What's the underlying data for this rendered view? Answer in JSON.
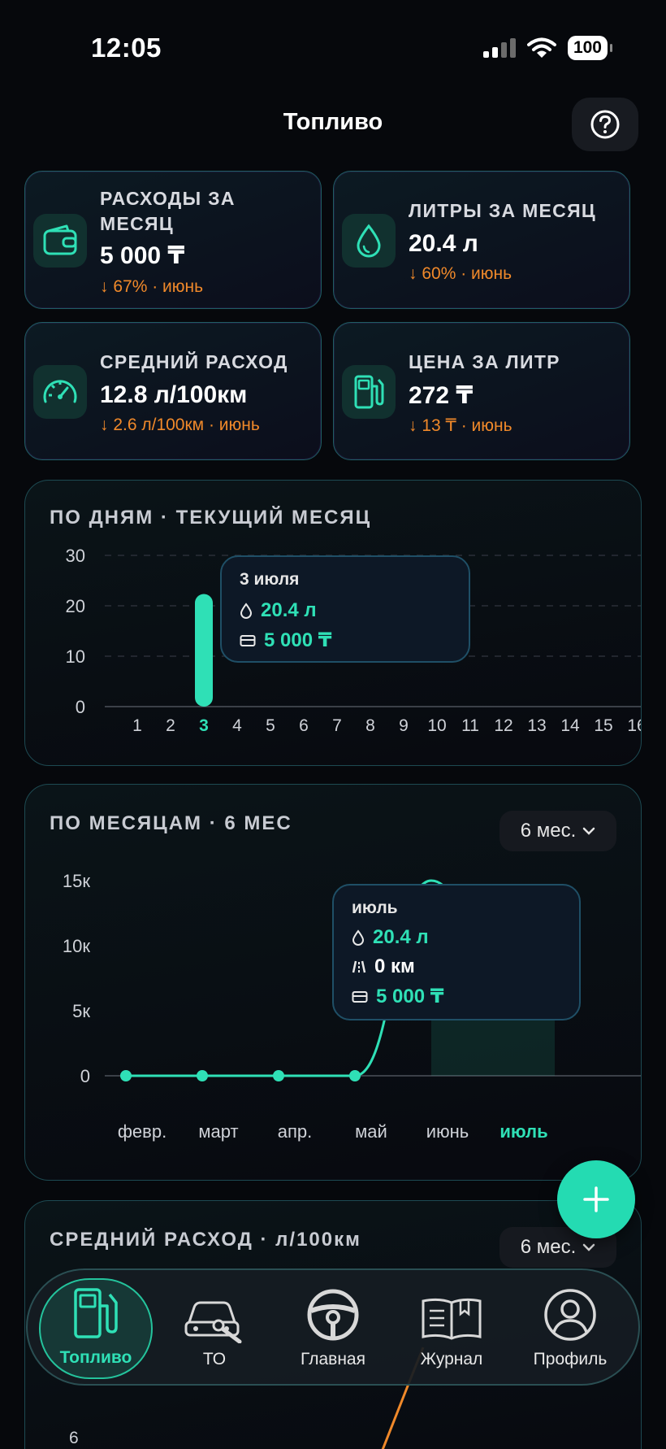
{
  "status": {
    "time": "12:05",
    "battery": "100"
  },
  "header": {
    "title": "Топливо"
  },
  "stats": [
    {
      "label": "РАСХОДЫ ЗА МЕСЯЦ",
      "value": "5 000 ₸",
      "delta": "↓ 67% · июнь",
      "icon": "wallet-icon"
    },
    {
      "label": "ЛИТРЫ ЗА МЕСЯЦ",
      "value": "20.4 л",
      "delta": "↓ 60% · июнь",
      "icon": "droplet-icon"
    },
    {
      "label": "СРЕДНИЙ РАСХОД",
      "value": "12.8 л/100км",
      "delta": "↓ 2.6 л/100км · июнь",
      "icon": "speedometer-icon"
    },
    {
      "label": "ЦЕНА ЗА ЛИТР",
      "value": "272 ₸",
      "delta": "↓ 13 ₸ · июнь",
      "icon": "fuel-pump-icon"
    }
  ],
  "daily": {
    "title": "ПО ДНЯМ · ТЕКУЩИЙ МЕСЯЦ",
    "tooltip": {
      "date": "3 июля",
      "liters": "20.4 л",
      "cost": "5 000 ₸"
    }
  },
  "monthly": {
    "title": "ПО МЕСЯЦАМ · 6 МЕС",
    "period": "6 мес.",
    "tooltip": {
      "month": "июль",
      "liters": "20.4 л",
      "distance": "0 км",
      "cost": "5 000 ₸"
    }
  },
  "avg": {
    "title": "СРЕДНИЙ РАСХОД · л/100км",
    "period": "6 мес.",
    "y_tick": "6"
  },
  "chart_data": [
    {
      "type": "bar",
      "title": "ПО ДНЯМ · ТЕКУЩИЙ МЕСЯЦ",
      "categories": [
        "1",
        "2",
        "3",
        "4",
        "5",
        "6",
        "7",
        "8",
        "9",
        "10",
        "11",
        "12",
        "13",
        "14",
        "15",
        "16"
      ],
      "values": [
        0,
        0,
        20.4,
        0,
        0,
        0,
        0,
        0,
        0,
        0,
        0,
        0,
        0,
        0,
        0,
        0
      ],
      "yticks": [
        "0",
        "10",
        "20",
        "30"
      ],
      "ylim": [
        0,
        30
      ],
      "highlight": "3",
      "grid": true
    },
    {
      "type": "line",
      "title": "ПО МЕСЯЦАМ · 6 МЕС",
      "categories": [
        "февр.",
        "март",
        "апр.",
        "май",
        "июнь",
        "июль"
      ],
      "values": [
        0,
        0,
        0,
        0,
        15000,
        5000
      ],
      "yticks": [
        "0",
        "5к",
        "10к",
        "15к"
      ],
      "ylim": [
        0,
        15000
      ],
      "highlight": "июль",
      "grid": false
    }
  ],
  "fab": {
    "icon": "plus-icon"
  },
  "nav": [
    {
      "label": "Топливо",
      "icon": "fuel-pump-icon",
      "active": true
    },
    {
      "label": "ТО",
      "icon": "car-service-icon",
      "active": false
    },
    {
      "label": "Главная",
      "icon": "steering-wheel-icon",
      "active": false
    },
    {
      "label": "Журнал",
      "icon": "book-icon",
      "active": false
    },
    {
      "label": "Профиль",
      "icon": "user-icon",
      "active": false
    }
  ]
}
